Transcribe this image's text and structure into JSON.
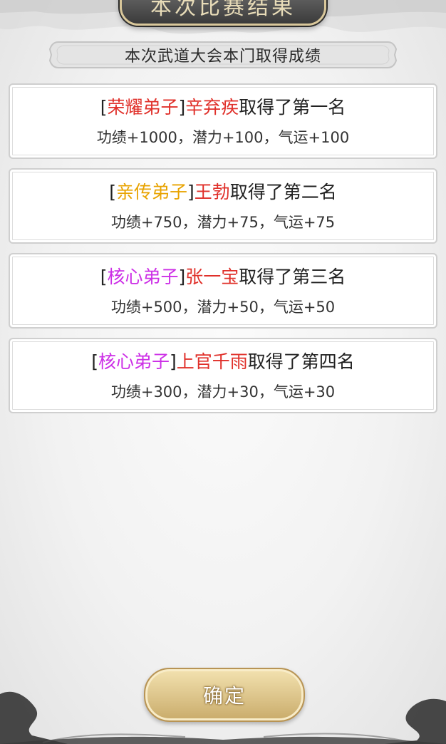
{
  "header": {
    "title": "本次比赛结果",
    "subtitle": "本次武道大会本门取得成绩"
  },
  "results": [
    {
      "bracket_open": "[",
      "rank_title": "荣耀弟子",
      "bracket_close": "]",
      "name": "辛弃疾",
      "placement": "取得了第一名",
      "rewards": "功绩+1000，潜力+100，气运+100",
      "rank_color": "#e0302a"
    },
    {
      "bracket_open": "[",
      "rank_title": "亲传弟子",
      "bracket_close": "]",
      "name": "王勃",
      "placement": "取得了第二名",
      "rewards": "功绩+750，潜力+75，气运+75",
      "rank_color": "#e8a300"
    },
    {
      "bracket_open": "[",
      "rank_title": "核心弟子",
      "bracket_close": "]",
      "name": "张一宝",
      "placement": "取得了第三名",
      "rewards": "功绩+500，潜力+50，气运+50",
      "rank_color": "#cc2ee6"
    },
    {
      "bracket_open": "[",
      "rank_title": "核心弟子",
      "bracket_close": "]",
      "name": "上官千雨",
      "placement": "取得了第四名",
      "rewards": "功绩+300，潜力+30，气运+30",
      "rank_color": "#cc2ee6"
    }
  ],
  "footer": {
    "confirm_label": "确定"
  },
  "colors": {
    "name": "#e0302a",
    "button": "#dcc48a"
  }
}
